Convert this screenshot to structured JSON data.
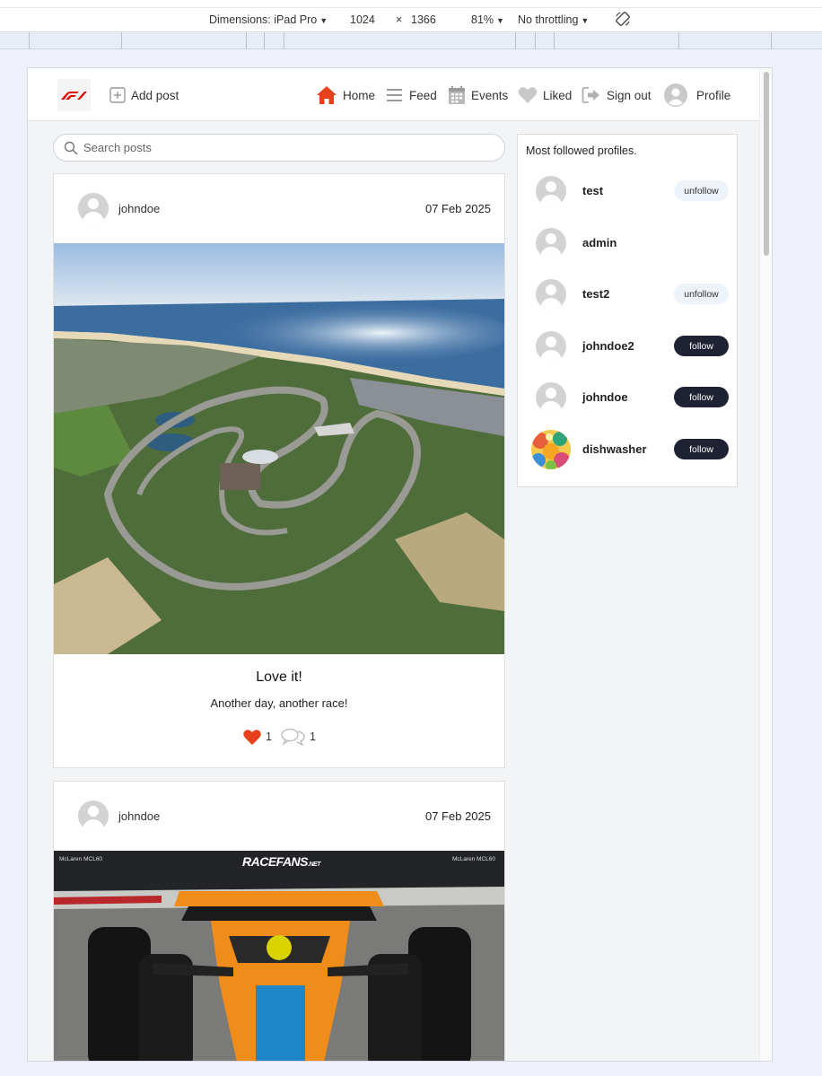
{
  "devtools": {
    "dimensions_label": "Dimensions: iPad Pro",
    "width": "1024",
    "times": "×",
    "height": "1366",
    "zoom": "81%",
    "throttling": "No throttling"
  },
  "nav": {
    "add_post": "Add post",
    "home": "Home",
    "feed": "Feed",
    "events": "Events",
    "liked": "Liked",
    "sign_out": "Sign out",
    "profile": "Profile"
  },
  "search": {
    "placeholder": "Search posts"
  },
  "posts": [
    {
      "username": "johndoe",
      "date": "07 Feb 2025",
      "title": "Love it!",
      "body": "Another day, another race!",
      "likes": "1",
      "comments": "1",
      "image": "aerial-race-circuit"
    },
    {
      "username": "johndoe",
      "date": "07 Feb 2025",
      "image_labels": {
        "left": "McLaren MCL60",
        "brand": "RACEFANS",
        "brand_suffix": ".NET",
        "right": "McLaren MCL60"
      },
      "image": "mclaren-f1-car"
    }
  ],
  "sidebar": {
    "title": "Most followed profiles.",
    "profiles": [
      {
        "name": "test",
        "action": "unfollow"
      },
      {
        "name": "admin",
        "action": ""
      },
      {
        "name": "test2",
        "action": "unfollow"
      },
      {
        "name": "johndoe2",
        "action": "follow"
      },
      {
        "name": "johndoe",
        "action": "follow"
      },
      {
        "name": "dishwasher",
        "action": "follow"
      }
    ]
  },
  "colors": {
    "accent": "#e8401c",
    "follow_bg": "#1f2233",
    "unfollow_bg": "#eef2fa"
  }
}
